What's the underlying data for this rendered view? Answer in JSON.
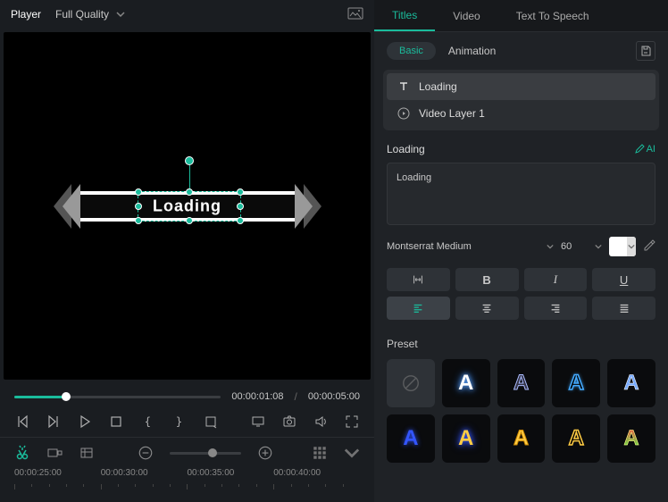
{
  "player": {
    "label": "Player",
    "quality": "Full Quality",
    "current_time": "00:00:01:08",
    "duration": "00:00:05:00",
    "preview_text": "Loading"
  },
  "timeline": {
    "labels": [
      "00:00:25:00",
      "00:00:30:00",
      "00:00:35:00",
      "00:00:40:00"
    ]
  },
  "panel": {
    "tabs": {
      "titles": "Titles",
      "video": "Video",
      "tts": "Text To Speech"
    },
    "sub": {
      "basic": "Basic",
      "animation": "Animation"
    },
    "layers": [
      {
        "type": "text",
        "label": "Loading"
      },
      {
        "type": "video",
        "label": "Video Layer 1"
      }
    ],
    "section_title": "Loading",
    "ai_label": "AI",
    "text_value": "Loading",
    "font_family": "Montserrat Medium",
    "font_size": "60",
    "preset_label": "Preset",
    "style_b": "B",
    "style_i": "I",
    "style_u": "U"
  }
}
